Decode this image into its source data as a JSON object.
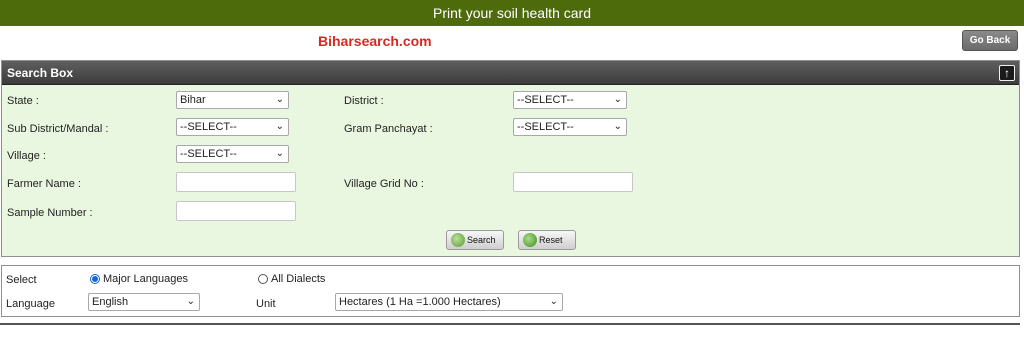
{
  "header": {
    "title": "Print your soil health card"
  },
  "watermark": "Biharsearch.com",
  "go_back_label": "Go Back",
  "search_box": {
    "title": "Search Box",
    "collapse_icon": "arrow-up",
    "fields": {
      "state": {
        "label": "State :",
        "value": "Bihar"
      },
      "district": {
        "label": "District :",
        "value": "--SELECT--"
      },
      "sub_district": {
        "label": "Sub District/Mandal :",
        "value": "--SELECT--"
      },
      "gram_panchayat": {
        "label": "Gram Panchayat :",
        "value": "--SELECT--"
      },
      "village": {
        "label": "Village :",
        "value": "--SELECT--"
      },
      "farmer_name": {
        "label": "Farmer Name :",
        "value": ""
      },
      "village_grid_no": {
        "label": "Village Grid No :",
        "value": ""
      },
      "sample_number": {
        "label": "Sample Number :",
        "value": ""
      }
    },
    "search_label": "Search",
    "reset_label": "Reset"
  },
  "options": {
    "select_label": "Select",
    "major_languages_label": "Major Languages",
    "all_dialects_label": "All Dialects",
    "selected_mode": "Major Languages",
    "language_label": "Language",
    "language_value": "English",
    "unit_label": "Unit",
    "unit_value": "Hectares (1 Ha =1.000 Hectares)"
  }
}
